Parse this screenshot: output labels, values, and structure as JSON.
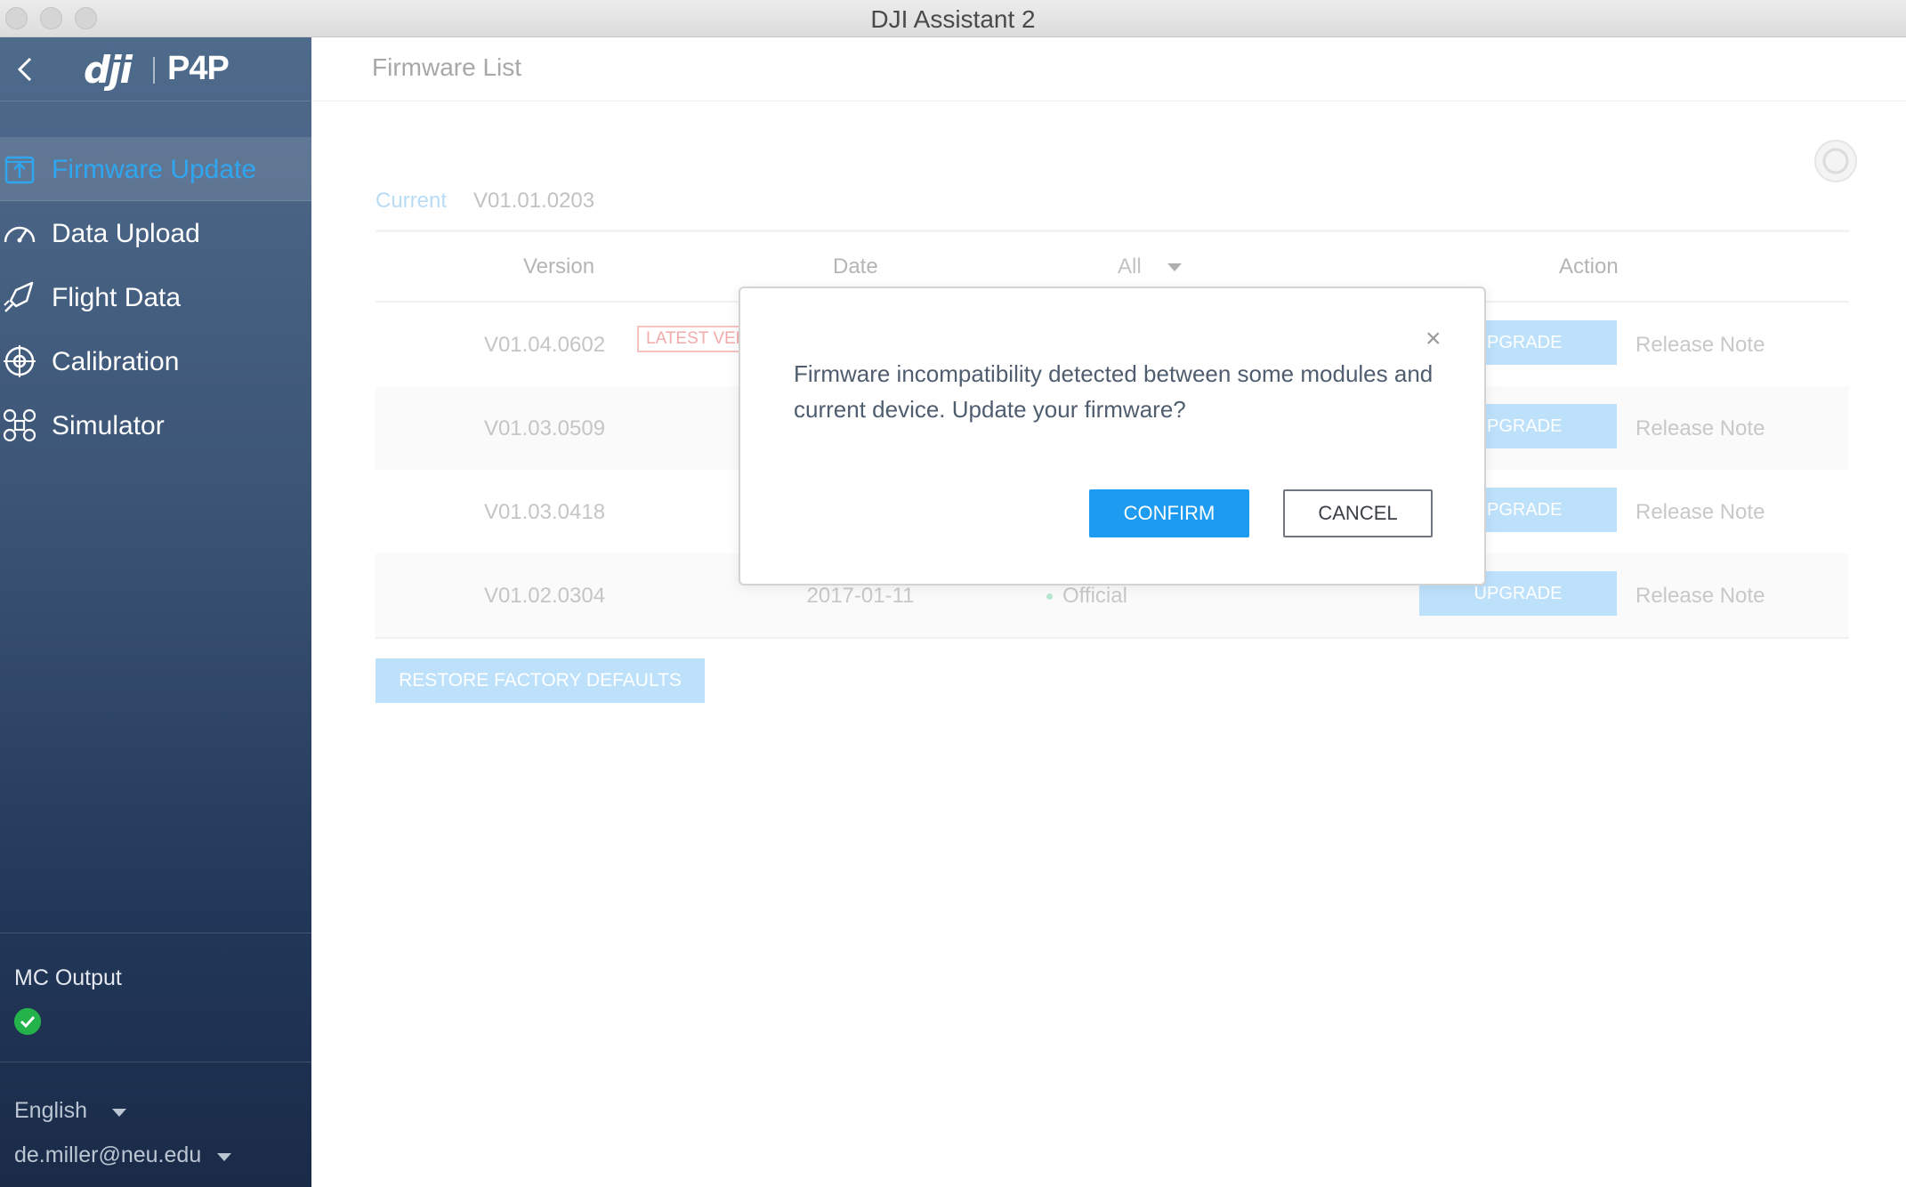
{
  "window": {
    "title": "DJI Assistant 2"
  },
  "sidebar": {
    "brand_logo": "dji",
    "model": "P4P",
    "items": [
      {
        "label": "Firmware Update",
        "icon": "firmware-update-icon",
        "active": true
      },
      {
        "label": "Data Upload",
        "icon": "gauge-icon",
        "active": false
      },
      {
        "label": "Flight Data",
        "icon": "rocket-icon",
        "active": false
      },
      {
        "label": "Calibration",
        "icon": "crosshair-icon",
        "active": false
      },
      {
        "label": "Simulator",
        "icon": "drone-icon",
        "active": false
      }
    ],
    "mc_output": {
      "label": "MC Output",
      "status": "ok"
    },
    "language": "English",
    "account": "de.miller@neu.edu"
  },
  "main": {
    "title": "Firmware List",
    "current_label": "Current",
    "current_version": "V01.01.0203",
    "columns": {
      "version": "Version",
      "date": "Date",
      "filter": "All",
      "action": "Action"
    },
    "rows": [
      {
        "version": "V01.04.0602",
        "badge": "LATEST VER",
        "date": "",
        "type": "",
        "action": "UPGRADE",
        "note": "Release Note"
      },
      {
        "version": "V01.03.0509",
        "badge": "",
        "date": "",
        "type": "",
        "action": "UPGRADE",
        "note": "Release Note"
      },
      {
        "version": "V01.03.0418",
        "badge": "",
        "date": "",
        "type": "",
        "action": "UPGRADE",
        "note": "Release Note"
      },
      {
        "version": "V01.02.0304",
        "badge": "",
        "date": "2017-01-11",
        "type": "Official",
        "action": "UPGRADE",
        "note": "Release Note"
      }
    ],
    "restore_label": "RESTORE FACTORY DEFAULTS"
  },
  "dialog": {
    "message": "Firmware incompatibility detected between some modules and current device. Update your firmware?",
    "confirm": "CONFIRM",
    "cancel": "CANCEL",
    "close_glyph": "×"
  },
  "colors": {
    "accent": "#1d9bf0",
    "active_nav": "#2fa6f0",
    "badge": "#f2aaaa",
    "status_ok": "#24b24a"
  }
}
